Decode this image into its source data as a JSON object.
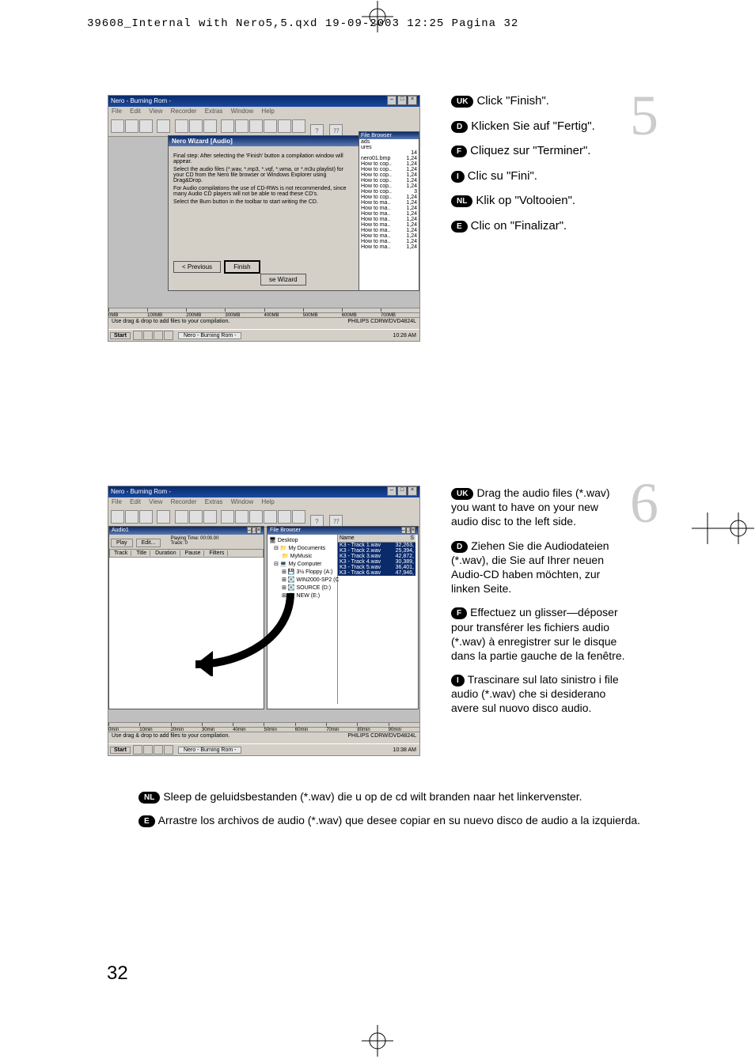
{
  "header": "39608_Internal with Nero5,5.qxd   19-09-2003   12:25   Pagina 32",
  "page_number": "32",
  "step5": {
    "number": "5",
    "lines": [
      {
        "lang": "UK",
        "text": "Click \"Finish\"."
      },
      {
        "lang": "D",
        "text": "Klicken Sie auf \"Fertig\"."
      },
      {
        "lang": "F",
        "text": "Cliquez sur \"Terminer\"."
      },
      {
        "lang": "I",
        "text": "Clic su \"Fini\"."
      },
      {
        "lang": "NL",
        "text": "Klik op \"Voltooien\"."
      },
      {
        "lang": "E",
        "text": "Clic on \"Finalizar\"."
      }
    ]
  },
  "step6": {
    "number": "6",
    "lines": [
      {
        "lang": "UK",
        "text": "Drag the audio files (*.wav) you want to have on your new audio disc to the left side."
      },
      {
        "lang": "D",
        "text": "Ziehen Sie die Audiodateien (*.wav), die Sie auf Ihrer neuen Audio-CD haben möchten, zur linken Seite."
      },
      {
        "lang": "F",
        "text": "Effectuez un glisser—déposer pour transférer les fichiers audio (*.wav) à enregistrer sur le disque dans la partie gauche de la fenêtre."
      },
      {
        "lang": "I",
        "text": "Trascinare sul lato sinistro i file audio (*.wav) che si desiderano avere sul nuovo disco audio."
      }
    ],
    "below": [
      {
        "lang": "NL",
        "text": "Sleep de geluidsbestanden (*.wav) die u op de cd wilt branden naar het linkervenster."
      },
      {
        "lang": "E",
        "text": "Arrastre los archivos de audio (*.wav) que desee copiar en su nuevo disco de audio a la izquierda."
      }
    ]
  },
  "screenshot1": {
    "title": "Nero - Burning Rom -",
    "menu": [
      "File",
      "Edit",
      "View",
      "Recorder",
      "Extras",
      "Window",
      "Help"
    ],
    "file_browser_title": "File Browser",
    "wizard_title": "Nero Wizard [Audio]",
    "wizard_body1": "Final step: After selecting the 'Finish' button a compilation window will appear.",
    "wizard_body2": "Select the audio files (*.wav, *.mp3, *.vqf, *.wma, or *.m3u playlist) for your CD from the Nero file browser or Windows Explorer using Drag&Drop.",
    "wizard_body3": "For Audio compilations the use of CD-RWs is not recommended, since many Audio CD players will not be able to read these CD's.",
    "wizard_body4": "Select the Burn button in the toolbar to start writing the CD.",
    "btn_prev": "< Previous",
    "btn_finish": "Finish",
    "btn_close": "se Wizard",
    "files": [
      {
        "name": "ads",
        "size": ""
      },
      {
        "name": "ures",
        "size": ""
      },
      {
        "name": "",
        "size": "14"
      },
      {
        "name": "nero01.bmp",
        "size": "1,24"
      },
      {
        "name": "How to cop..",
        "size": "1,24"
      },
      {
        "name": "How to cop..",
        "size": "1,24"
      },
      {
        "name": "How to cop..",
        "size": "1,24"
      },
      {
        "name": "How to cop..",
        "size": "1,24"
      },
      {
        "name": "How to cop..",
        "size": "1,24"
      },
      {
        "name": "How to cop..",
        "size": "3"
      },
      {
        "name": "How to cop..",
        "size": "1,24"
      },
      {
        "name": "How to ma..",
        "size": "1,24"
      },
      {
        "name": "How to ma..",
        "size": "1,24"
      },
      {
        "name": "How to ma..",
        "size": "1,24"
      },
      {
        "name": "How to ma..",
        "size": "1,24"
      },
      {
        "name": "How to ma..",
        "size": "1,24"
      },
      {
        "name": "How to ma..",
        "size": "1,24"
      },
      {
        "name": "How to ma..",
        "size": "1,24"
      },
      {
        "name": "How to ma..",
        "size": "1,24"
      },
      {
        "name": "How to ma..",
        "size": "1,24"
      }
    ],
    "capacity_labels": [
      "0MB",
      "100MB",
      "200MB",
      "300MB",
      "400MB",
      "500MB",
      "600MB",
      "700MB"
    ],
    "status_left": "Use drag & drop to add files to your compilation.",
    "status_right": "PHILIPS CDRW/DVD4824L",
    "start": "Start",
    "taskbar_app": "Nero - Burning Rom -",
    "clock": "10:28 AM"
  },
  "screenshot2": {
    "title": "Nero - Burning Rom -",
    "menu": [
      "File",
      "Edit",
      "View",
      "Recorder",
      "Extras",
      "Window",
      "Help"
    ],
    "audio_title": "Audio1",
    "play_btn": "Play",
    "edit_btn": "Edit...",
    "playing_label": "Playing Time:",
    "playing_value": "00:00.00",
    "track_label": "Track:",
    "track_value": "0",
    "columns": [
      "Track",
      "Title",
      "Duration",
      "Pause",
      "Filters"
    ],
    "fb_title": "File Browser",
    "tree": [
      "Desktop",
      "My Documents",
      "MyMusic",
      "My Computer",
      "3½ Floppy (A:)",
      "WIN2000-SP2 (C",
      "SOURCE (D:)",
      "NEW (E:)"
    ],
    "list_head_name": "Name",
    "list_head_size": "S",
    "tracks": [
      {
        "name": "K3 - Track 1.wav",
        "size": "32,263,"
      },
      {
        "name": "K3 - Track 2.wav",
        "size": "25,394,"
      },
      {
        "name": "K3 - Track 3.wav",
        "size": "42,872,"
      },
      {
        "name": "K3 - Track 4.wav",
        "size": "30,389,"
      },
      {
        "name": "K3 - Track 5.wav",
        "size": "36,401,"
      },
      {
        "name": "K3 - Track 6.wav",
        "size": "47,946,"
      }
    ],
    "capacity_labels": [
      "0min",
      "10min",
      "20min",
      "30min",
      "40min",
      "50min",
      "60min",
      "70min",
      "80min",
      "90min"
    ],
    "status_left": "Use drag & drop to add files to your compilation.",
    "status_right": "PHILIPS CDRW/DVD4824L",
    "start": "Start",
    "taskbar_app": "Nero - Burning Rom -",
    "clock": "10:38 AM"
  }
}
